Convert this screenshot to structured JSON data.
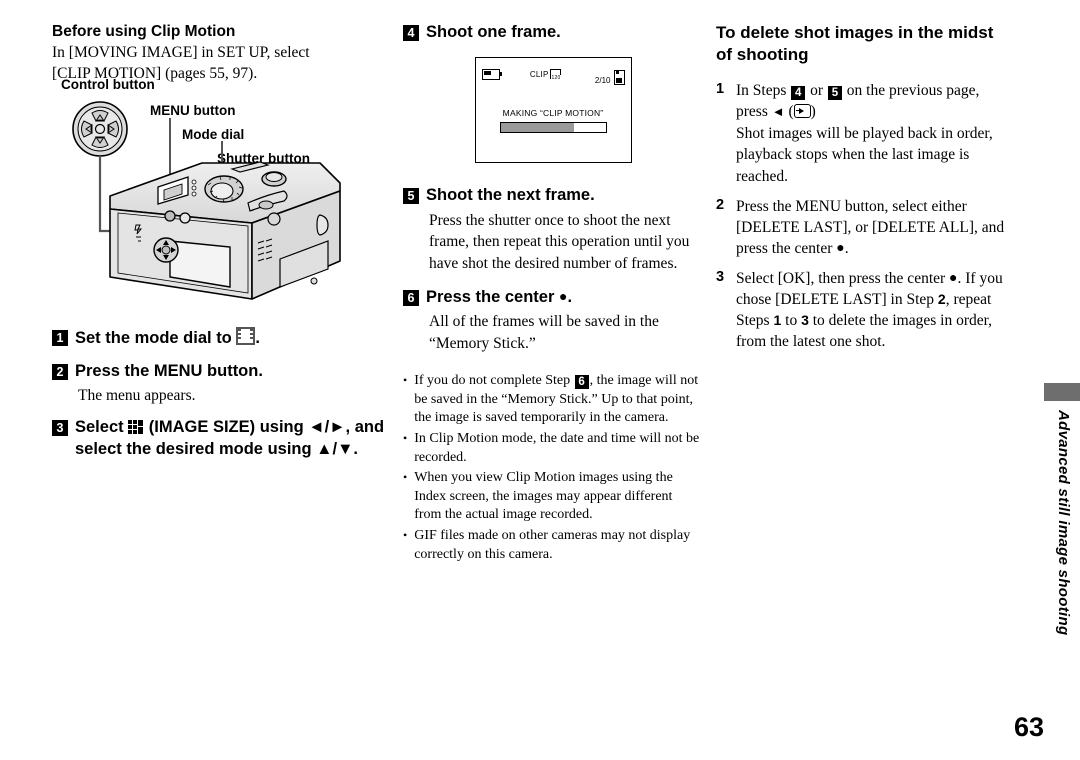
{
  "page": {
    "number": "63",
    "section_tab": "Advanced still image shooting"
  },
  "left_column": {
    "heading": "Before using Clip Motion",
    "intro_line1": "In [MOVING IMAGE] in SET UP, select",
    "intro_line2": "[CLIP MOTION] (pages 55, 97).",
    "diagram": {
      "labels": {
        "control_button": "Control button",
        "menu_button": "MENU button",
        "mode_dial": "Mode dial",
        "shutter_button": "Shutter button"
      }
    },
    "steps": [
      {
        "number": "1",
        "title_before": "Set the mode dial to ",
        "icon": "film-strip-icon",
        "title_after": ".",
        "body": ""
      },
      {
        "number": "2",
        "title_before": "Press the MENU button.",
        "icon": "",
        "title_after": "",
        "body": "The menu appears."
      },
      {
        "number": "3",
        "title_before": "Select ",
        "icon": "image-size-icon",
        "title_after": " (IMAGE SIZE) using ◄/►, and select the desired mode using ▲/▼.",
        "body": ""
      }
    ]
  },
  "mid_column": {
    "step4": {
      "number": "4",
      "title": "Shoot one frame."
    },
    "lcd": {
      "battery_icon": "battery-icon",
      "clip_label": "CLIP",
      "clip_frames": "120",
      "counter": "2/10",
      "memory_stick_icon": "memory-stick-icon",
      "message": "MAKING “CLIP MOTION”",
      "progress_percent": 70
    },
    "step5": {
      "number": "5",
      "title": "Shoot the next frame.",
      "body": "Press the shutter once to shoot the next frame, then repeat this operation until you have shot the desired number of frames."
    },
    "step6": {
      "number": "6",
      "title_before": "Press the center ",
      "title_after": ".",
      "body": "All of the frames will be saved in the “Memory Stick.”"
    },
    "notes": [
      {
        "part1": "If you do not complete Step ",
        "badge": "6",
        "part2": ", the image will not be saved in the “Memory Stick.” Up to that point, the image is saved temporarily in the camera."
      },
      {
        "part1": "In Clip Motion mode, the date and time will not be recorded.",
        "badge": "",
        "part2": ""
      },
      {
        "part1": "When you view Clip Motion images using the Index screen, the images may appear different from the actual image recorded.",
        "badge": "",
        "part2": ""
      },
      {
        "part1": "GIF files made on other cameras may not display correctly on this camera.",
        "badge": "",
        "part2": ""
      }
    ]
  },
  "right_column": {
    "heading": "To delete shot images in the midst of shooting",
    "steps": [
      {
        "number": "1",
        "text_a": "In Steps ",
        "badge_a": "4",
        "text_b": " or ",
        "badge_b": "5",
        "text_c": " on the previous page, press ",
        "arrow": "◄",
        "text_d": "",
        "sub": "Shot images will be played back in order, playback stops when the last image is reached."
      },
      {
        "number": "2",
        "text_a": "Press the MENU button, select either [DELETE LAST], or [DELETE ALL], and press the center ",
        "badge_a": "",
        "text_b": "",
        "badge_b": "",
        "text_c": "",
        "arrow": "",
        "text_d": ".",
        "sub": ""
      },
      {
        "number": "3",
        "text_a": "Select [OK], then press the center ",
        "badge_a": "",
        "text_b": "",
        "badge_b": "",
        "text_c": "",
        "arrow": "",
        "text_d": ". If you chose [DELETE LAST] in Step ",
        "sub": ""
      }
    ],
    "step3_tail": {
      "step_ref_2": "2",
      "mid": ", repeat Steps ",
      "step_ref_1": "1",
      "to": " to ",
      "step_ref_3": "3",
      "end": " to delete the images in order, from the latest one shot."
    }
  },
  "colors": {
    "tab_gray": "#6e6e6e",
    "progress_fill": "#9a9a9a",
    "ink": "#000000"
  }
}
